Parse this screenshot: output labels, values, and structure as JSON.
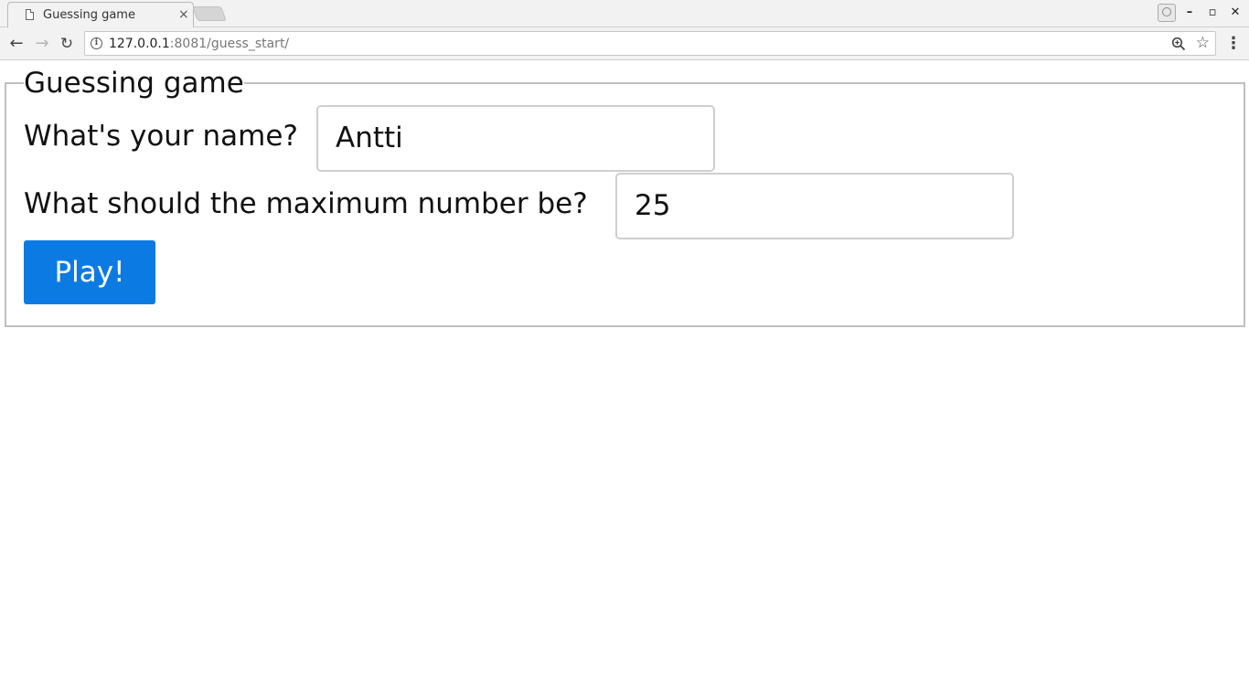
{
  "browser": {
    "tab_title": "Guessing game",
    "tab_close": "×",
    "url_host": "127.0.0.1",
    "url_rest": ":8081/guess_start/",
    "back_glyph": "←",
    "forward_glyph": "→",
    "reload_glyph": "↻",
    "star_glyph": "☆",
    "menu_glyph": "⋮",
    "info_glyph": "i",
    "minimize_glyph": "–",
    "maximize_glyph": "▫",
    "close_glyph": "✕"
  },
  "form": {
    "legend": "Guessing game",
    "name_label": "What's your name?",
    "name_value": "Antti",
    "max_label": "What should the maximum number be?",
    "max_value": "25",
    "play_label": "Play!"
  },
  "colors": {
    "button_bg": "#0b7be3",
    "button_text": "#ffffff",
    "fieldset_border": "#c0c0c0"
  },
  "icons": {
    "tab": "page-icon",
    "back": "arrow-left-icon",
    "forward": "arrow-right-icon",
    "reload": "reload-icon",
    "info": "info-icon",
    "zoom": "zoom-icon",
    "bookmark": "star-icon",
    "menu": "kebab-menu-icon",
    "profile": "profile-icon"
  }
}
